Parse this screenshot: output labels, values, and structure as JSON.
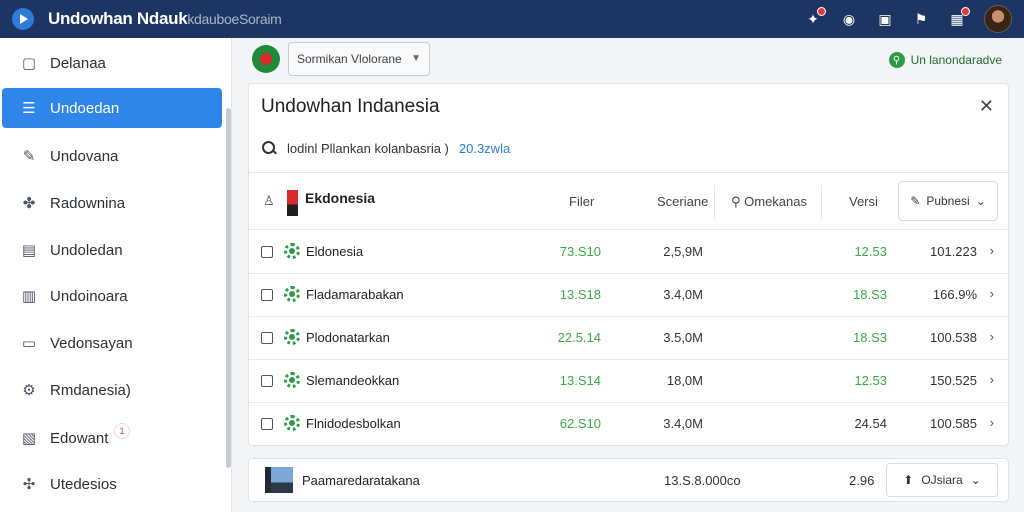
{
  "app": {
    "title": "Undowhan Ndauk",
    "subtitle": "kdauboeSoraim"
  },
  "topbar": {
    "icons": [
      "bell-icon",
      "help-icon",
      "chat-icon",
      "flag-icon",
      "calendar-icon"
    ]
  },
  "sidebar": {
    "items": [
      {
        "label": "Delanaa",
        "icon": "folder-icon"
      },
      {
        "label": "Undoedan",
        "icon": "list-icon"
      },
      {
        "label": "Undovana",
        "icon": "pencil-icon"
      },
      {
        "label": "Radownina",
        "icon": "puzzle-icon"
      },
      {
        "label": "Undoledan",
        "icon": "document-icon"
      },
      {
        "label": "Undoinoara",
        "icon": "page-icon"
      },
      {
        "label": "Vedonsayan",
        "icon": "window-icon"
      },
      {
        "label": "Rmdanesia)",
        "icon": "gear-icon"
      },
      {
        "label": "Edowant",
        "icon": "edit-icon",
        "badge": "1"
      },
      {
        "label": "Utedesios",
        "icon": "share-icon"
      }
    ]
  },
  "toolbar": {
    "select_value": "Sormikan Vlolorane",
    "link_label": "Un lanondaradve"
  },
  "panel": {
    "title": "Undowhan Indanesia",
    "search_text": "lodinl Pllankan kolanbasria )",
    "search_count": "20.3zwla",
    "header": {
      "name": "Ekdonesia",
      "col1": "Filer",
      "col2": "Sceriane",
      "col3": "Omekanas",
      "col4": "Versi",
      "button": "Pubnesi"
    },
    "rows": [
      {
        "name": "Eldonesia",
        "c1": "73.S10",
        "c2": "2,5,9M",
        "c3": "12.53",
        "c4": "101.223"
      },
      {
        "name": "Fladamarabakan",
        "c1": "13.S18",
        "c2": "3.4,0M",
        "c3": "18.S3",
        "c4": "166.9%"
      },
      {
        "name": "Plodonatarkan",
        "c1": "22.5.14",
        "c2": "3.5,0M",
        "c3": "18.S3",
        "c4": "100.538"
      },
      {
        "name": "Slemandeokkan",
        "c1": "13.S14",
        "c2": "18,0M",
        "c3": "12.53",
        "c4": "150.525"
      },
      {
        "name": "Flnidodesbolkan",
        "c1": "62.S10",
        "c2": "3.4,0M",
        "c3": "24.54",
        "c4": "100.585"
      }
    ]
  },
  "bottom_card": {
    "name": "Paamaredaratakana",
    "value1": "13.S.8.000co",
    "value2": "2.96",
    "button": "OJsiara"
  }
}
